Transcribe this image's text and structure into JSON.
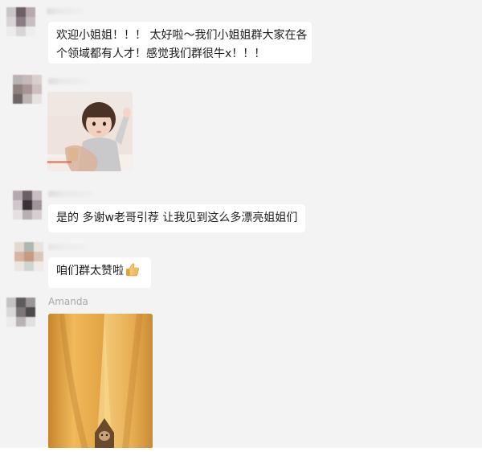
{
  "conversation": {
    "messages": [
      {
        "sender_name": "",
        "type": "text",
        "lines": [
          "欢迎小姐姐！！！ 太好啦～我们小姐姐群大家在各",
          "个领域都有人才！感觉我们群很牛x！！！"
        ]
      },
      {
        "sender_name": "",
        "type": "image",
        "image_description": "girl-raising-hand-photo"
      },
      {
        "sender_name": "",
        "type": "text",
        "lines": [
          "是的 多谢w老哥引荐 让我见到这么多漂亮姐姐们"
        ]
      },
      {
        "sender_name": "",
        "type": "text",
        "lines": [
          "咱们群太赞啦"
        ],
        "trailing_emoji": "thumbs-up-icon"
      },
      {
        "sender_name": "Amanda",
        "type": "image",
        "image_description": "yellow-curtain-photo"
      }
    ]
  },
  "colors": {
    "background": "#f3f3f3",
    "bubble": "#ffffff",
    "text": "#1b1b1b",
    "sender_name": "#a7a7a7"
  }
}
